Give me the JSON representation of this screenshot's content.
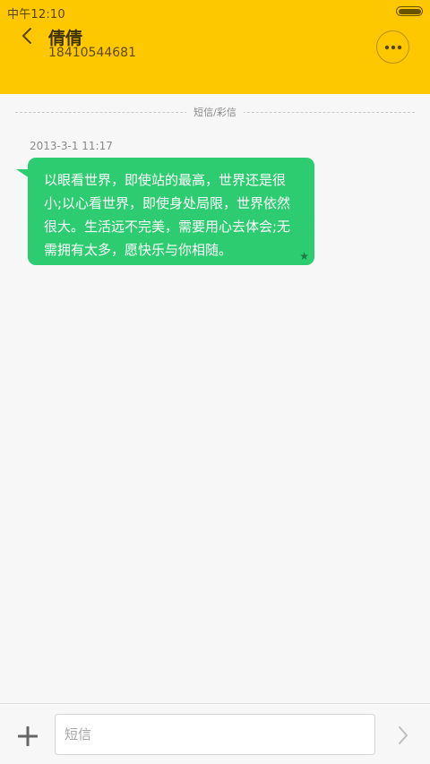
{
  "status_bar": {
    "time": "中午12:10",
    "battery_level": 1.0
  },
  "header": {
    "contact_name": "倩倩",
    "phone_number": "18410544681"
  },
  "thread": {
    "type_divider": "短信/彩信",
    "messages": [
      {
        "timestamp": "2013-3-1 11:17",
        "text": "以眼看世界，即使站的最高，世界还是很小;以心看世界，即使身处局限，世界依然很大。生活远不完美，需要用心去体会;无需拥有太多，愿快乐与你相随。",
        "starred": true
      }
    ]
  },
  "composer": {
    "placeholder": "短信",
    "value": ""
  },
  "icons": {
    "back": "chevron-left-icon",
    "more": "more-dots-icon",
    "star": "star-icon",
    "add": "plus-icon",
    "send": "chevron-right-icon"
  },
  "colors": {
    "header_bg": "#fec800",
    "bubble_bg": "#2ecc71",
    "page_bg": "#f7f7f7"
  }
}
